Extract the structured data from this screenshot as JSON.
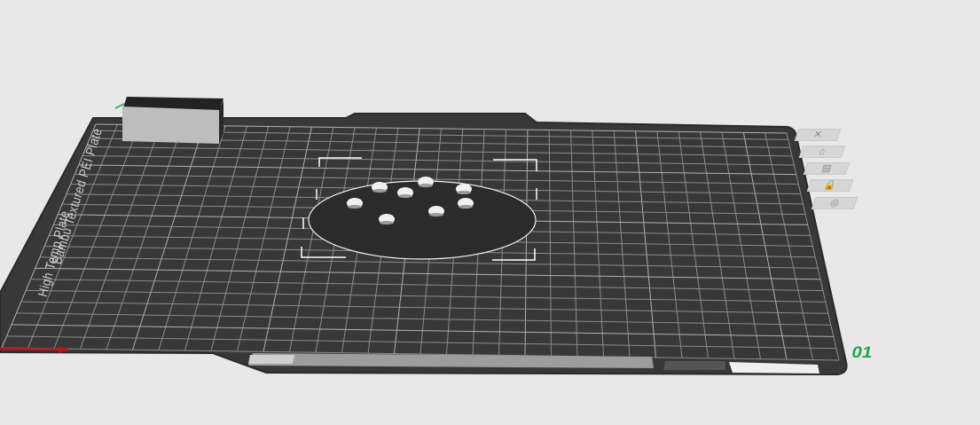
{
  "app": {
    "title": ""
  },
  "plate": {
    "side_label_1": "Bambu Textured PEI Plate",
    "side_label_2": "High Temp Plate",
    "number": "01",
    "name_bar_text": "",
    "colors": {
      "background": "#e8e8e8",
      "plate": "#383838",
      "grid": "#8c8c8c",
      "model": "#2b2b2b",
      "axis_x": "#c0141c",
      "number": "#1fa84a"
    }
  },
  "plate_tools": [
    {
      "name": "close",
      "icon": "close-icon",
      "glyph": "✕"
    },
    {
      "name": "orient",
      "icon": "orient-icon",
      "glyph": "⌂"
    },
    {
      "name": "arrange",
      "icon": "arrange-icon",
      "glyph": "▤"
    },
    {
      "name": "lock",
      "icon": "lock-icon",
      "glyph": "🔒"
    },
    {
      "name": "settings",
      "icon": "settings-icon",
      "glyph": "◎"
    }
  ]
}
